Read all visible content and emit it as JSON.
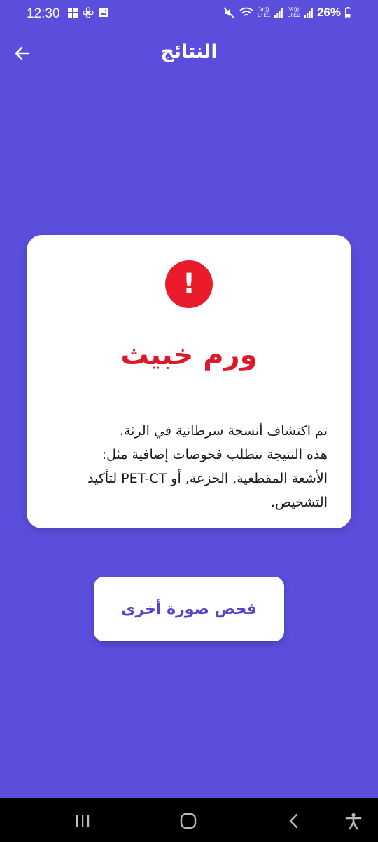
{
  "status_bar": {
    "time": "12:30",
    "left_icons": [
      "windows-icon",
      "fan-icon",
      "image-icon"
    ],
    "volte1": "Vo))",
    "lte1": "LTE1",
    "volte2": "Vo))",
    "lte2": "LTE2",
    "battery": "26%"
  },
  "header": {
    "title": "النتائج",
    "back_icon": "arrow-left-icon"
  },
  "result": {
    "icon": "exclamation-icon",
    "title": "ورم خبيث",
    "description_lines": [
      "تم اكتشاف أنسجة سرطانية في الرئة.",
      "هذه النتيجة تتطلب فحوصات إضافية مثل:",
      "الأشعة المقطعية, الخزعة, أو PET-CT لتأكيد",
      "التشخيص."
    ],
    "accent_color": "#e41e2b"
  },
  "actions": {
    "retry_label": "فحص صورة أخرى"
  },
  "colors": {
    "background": "#5b4edc",
    "card": "#ffffff",
    "button_text": "#5146c7"
  },
  "nav_bar": {
    "icons": [
      "recents-icon",
      "home-icon",
      "back-icon",
      "accessibility-icon"
    ]
  }
}
